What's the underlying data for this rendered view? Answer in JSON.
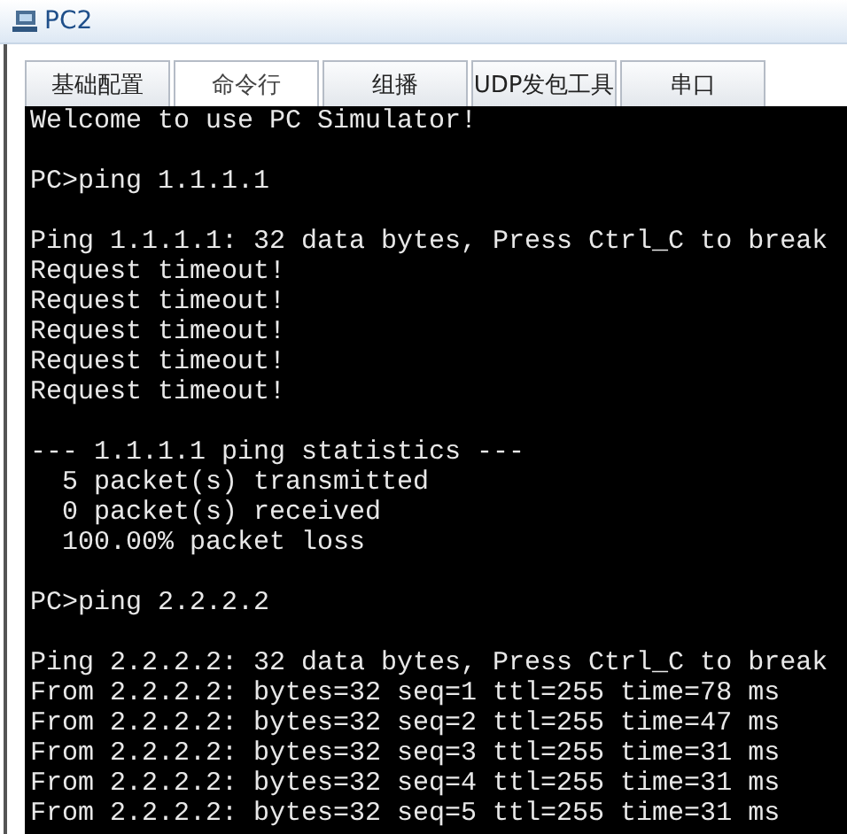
{
  "window": {
    "title": "PC2"
  },
  "tabs": [
    {
      "label": "基础配置",
      "selected": false
    },
    {
      "label": "命令行",
      "selected": true
    },
    {
      "label": "组播",
      "selected": false
    },
    {
      "label": "UDP发包工具",
      "selected": false
    },
    {
      "label": "串口",
      "selected": false
    }
  ],
  "terminal": {
    "blocks": [
      [
        "Welcome to use PC Simulator!"
      ],
      [
        "PC>ping 1.1.1.1"
      ],
      [
        "Ping 1.1.1.1: 32 data bytes, Press Ctrl_C to break",
        "Request timeout!",
        "Request timeout!",
        "Request timeout!",
        "Request timeout!",
        "Request timeout!"
      ],
      [
        "--- 1.1.1.1 ping statistics ---",
        "  5 packet(s) transmitted",
        "  0 packet(s) received",
        "  100.00% packet loss"
      ],
      [
        "PC>ping 2.2.2.2"
      ],
      [
        "Ping 2.2.2.2: 32 data bytes, Press Ctrl_C to break",
        "From 2.2.2.2: bytes=32 seq=1 ttl=255 time=78 ms",
        "From 2.2.2.2: bytes=32 seq=2 ttl=255 time=47 ms",
        "From 2.2.2.2: bytes=32 seq=3 ttl=255 time=31 ms",
        "From 2.2.2.2: bytes=32 seq=4 ttl=255 time=31 ms",
        "From 2.2.2.2: bytes=32 seq=5 ttl=255 time=31 ms"
      ]
    ]
  }
}
